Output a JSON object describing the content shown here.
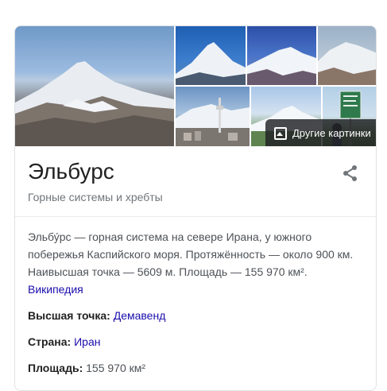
{
  "gallery": {
    "more_images_label": "Другие картинки",
    "sign_text": "mountain-sign"
  },
  "entity": {
    "title": "Эльбурс",
    "subtitle": "Горные системы и хребты",
    "description": "Эльбу́рс — горная система на севере Ирана, у южного побережья Каспийского моря. Протяжённость — около 900 км. Наивысшая точка — 5609 м. Площадь — 155 970 км².",
    "source_link": "Википедия"
  },
  "facts": [
    {
      "label": "Высшая точка:",
      "value": "Демавенд",
      "is_link": true
    },
    {
      "label": "Страна:",
      "value": "Иран",
      "is_link": true
    },
    {
      "label": "Площадь:",
      "value": "155 970 км²",
      "is_link": false
    }
  ]
}
